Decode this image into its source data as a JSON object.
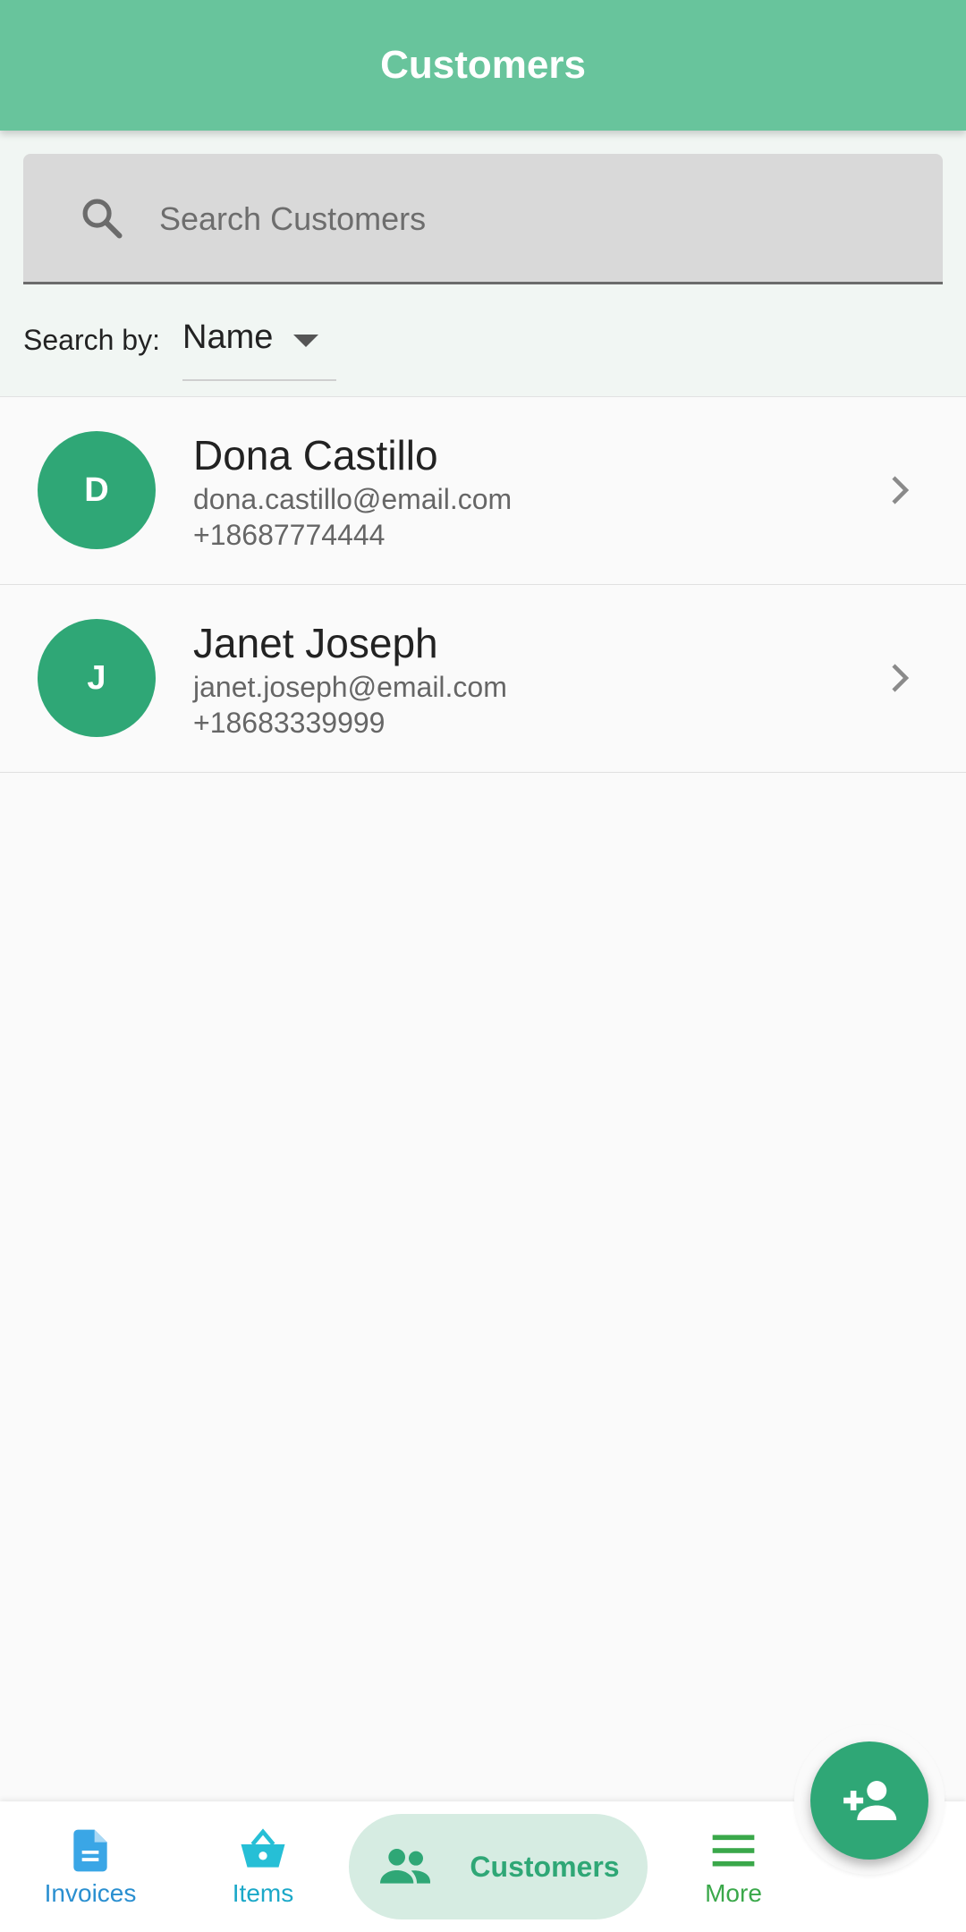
{
  "app_bar": {
    "title": "Customers"
  },
  "search": {
    "placeholder": "Search Customers",
    "value": "",
    "search_by_label": "Search by:",
    "search_by_value": "Name"
  },
  "customers": [
    {
      "initial": "D",
      "name": "Dona Castillo",
      "email": "dona.castillo@email.com",
      "phone": "+18687774444"
    },
    {
      "initial": "J",
      "name": "Janet Joseph",
      "email": "janet.joseph@email.com",
      "phone": "+18683339999"
    }
  ],
  "bottom_nav": {
    "items": [
      {
        "label": "Invoices",
        "icon": "document-icon"
      },
      {
        "label": "Items",
        "icon": "basket-icon"
      },
      {
        "label": "Customers",
        "icon": "people-icon",
        "selected": true
      },
      {
        "label": "More",
        "icon": "menu-icon"
      }
    ]
  },
  "fab": {
    "icon": "add-person-icon"
  },
  "colors": {
    "app_bar": "#68c49c",
    "accent": "#2fa776",
    "search_background": "#d9d9d9",
    "invoices": "#2a8fd0",
    "items": "#1ba8c8",
    "more": "#3aa84a"
  }
}
